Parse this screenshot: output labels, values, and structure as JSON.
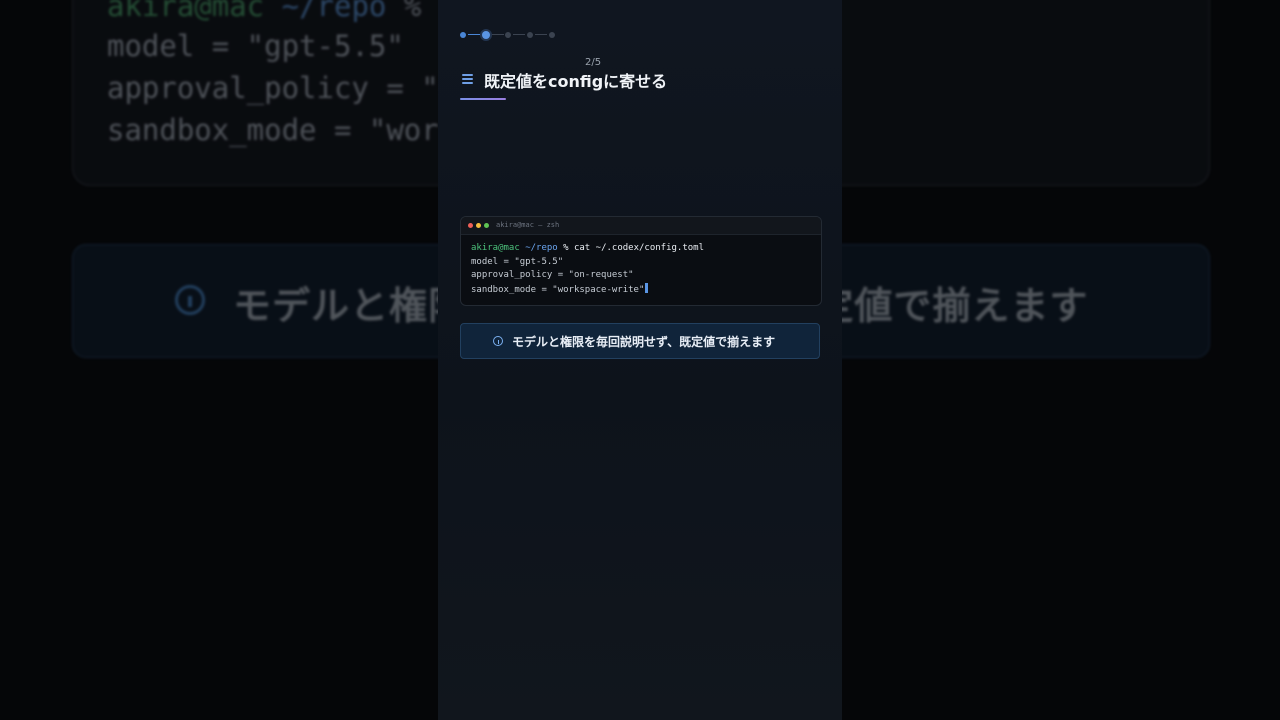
{
  "background": {
    "terminal_lines": [
      {
        "user": "akira@mac",
        "path": "~/repo",
        "rest": " % co"
      },
      {
        "text": "model = \"gpt-5.5\""
      },
      {
        "text": "approval_policy = \"o"
      },
      {
        "text": "sandbox_mode = \"work"
      }
    ],
    "callout_text": "モデルと権限を毎回説明せず、既定値で揃えます"
  },
  "progress": {
    "current": 2,
    "total": 5,
    "label": "2/5"
  },
  "heading": {
    "icon": "list-icon",
    "title": "既定値をconfigに寄せる"
  },
  "terminal": {
    "title": "akira@mac — zsh",
    "prompt_user": "akira@mac",
    "prompt_path": "~/repo",
    "command": " % cat ~/.codex/config.toml",
    "lines": [
      "model = \"gpt-5.5\"",
      "approval_policy = \"on-request\"",
      "sandbox_mode = \"workspace-write\""
    ]
  },
  "callout": {
    "icon": "info-icon",
    "text": "モデルと権限を毎回説明せず、既定値で揃えます"
  },
  "colors": {
    "accent": "#5a95e4",
    "prompt_user": "#4cc17b",
    "prompt_path": "#6aa4ee",
    "callout_bg": "#10243a"
  }
}
